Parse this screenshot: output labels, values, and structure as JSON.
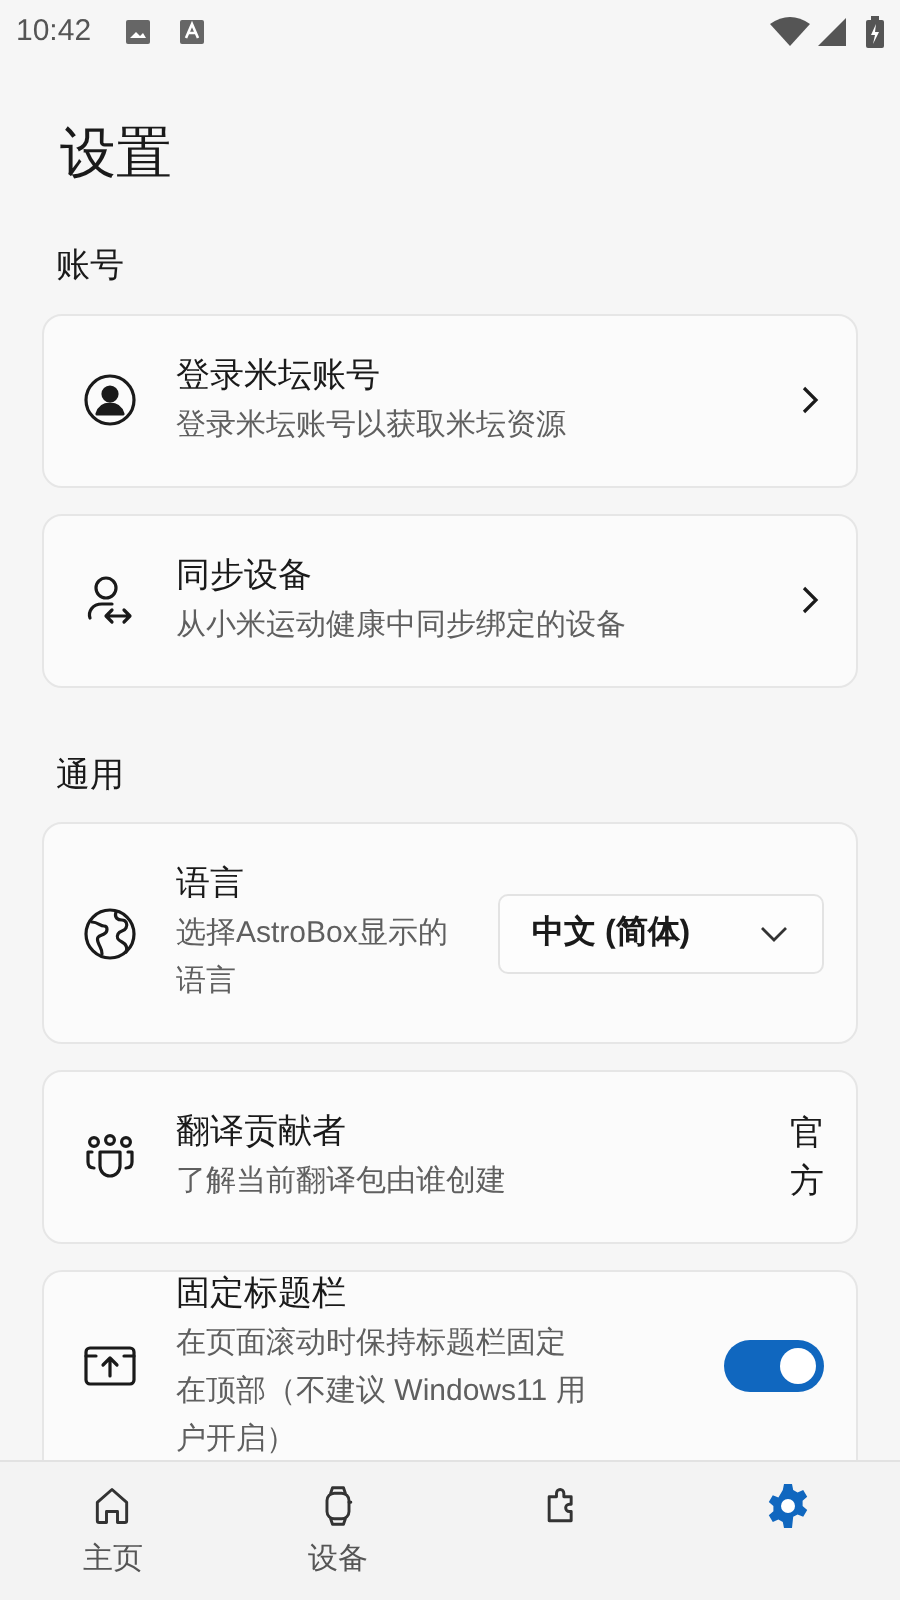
{
  "status_bar": {
    "time": "10:42"
  },
  "title": "设置",
  "sections": [
    {
      "heading": "账号",
      "items": [
        {
          "kind": "link",
          "title": "登录米坛账号",
          "subtitle": "登录米坛账号以获取米坛资源"
        },
        {
          "kind": "link",
          "title": "同步设备",
          "subtitle": "从小米运动健康中同步绑定的设备"
        }
      ]
    },
    {
      "heading": "通用",
      "items": [
        {
          "kind": "dropdown",
          "title": "语言",
          "subtitle": "选择AstroBox显示的语言",
          "value": "中文 (简体)"
        },
        {
          "kind": "value",
          "title": "翻译贡献者",
          "subtitle": "了解当前翻译包由谁创建",
          "value": "官方"
        },
        {
          "kind": "toggle",
          "title": "固定标题栏",
          "subtitle": "在页面滚动时保持标题栏固定在顶部（不建议 Windows11 用户开启）",
          "on": true
        }
      ]
    }
  ],
  "nav": [
    {
      "label": "主页",
      "selected": false
    },
    {
      "label": "设备",
      "selected": false
    },
    {
      "selected": false
    },
    {
      "selected": true
    }
  ]
}
